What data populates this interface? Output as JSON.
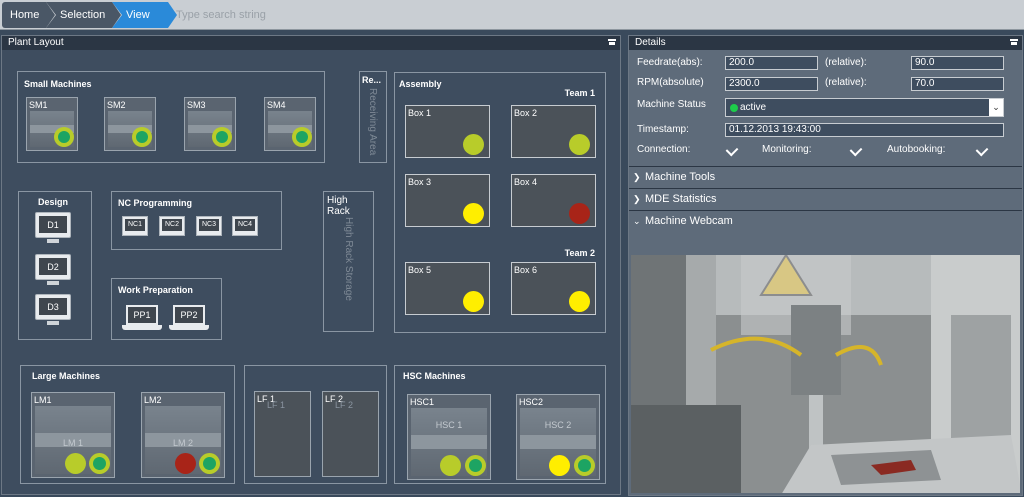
{
  "breadcrumb": {
    "home": "Home",
    "selection": "Selection",
    "view": "View",
    "search_placeholder": "Type search string"
  },
  "plant_layout": {
    "title": "Plant Layout",
    "small_machines": {
      "title": "Small Machines",
      "items": [
        {
          "label": "SM1"
        },
        {
          "label": "SM2"
        },
        {
          "label": "SM3"
        },
        {
          "label": "SM4"
        }
      ]
    },
    "receiving": {
      "label": "Re...",
      "vertical": "Receiving Area"
    },
    "assembly": {
      "title": "Assembly",
      "team1": "Team 1",
      "team2": "Team 2",
      "boxes": [
        {
          "label": "Box 1",
          "status_color": "#b8cc2a"
        },
        {
          "label": "Box 2",
          "status_color": "#b8cc2a"
        },
        {
          "label": "Box 3",
          "status_color": "#ffee00"
        },
        {
          "label": "Box 4",
          "status_color": "#a82418"
        },
        {
          "label": "Box 5",
          "status_color": "#ffee00"
        },
        {
          "label": "Box 6",
          "status_color": "#ffee00"
        }
      ]
    },
    "design": {
      "title": "Design",
      "items": [
        {
          "label": "D1"
        },
        {
          "label": "D2"
        },
        {
          "label": "D3"
        }
      ]
    },
    "nc_programming": {
      "title": "NC Programming",
      "items": [
        {
          "label": "NC1"
        },
        {
          "label": "NC2"
        },
        {
          "label": "NC3"
        },
        {
          "label": "NC4"
        }
      ]
    },
    "high_rack": {
      "label": "High Rack",
      "vertical": "High Rack Storage"
    },
    "work_preparation": {
      "title": "Work Preparation",
      "items": [
        {
          "label": "PP1"
        },
        {
          "label": "PP2"
        }
      ]
    },
    "large_machines": {
      "title": "Large Machines",
      "items": [
        {
          "label": "LM1",
          "inner": "LM 1",
          "status_color": "#b8cc2a"
        },
        {
          "label": "LM2",
          "inner": "LM 2",
          "status_color": "#a82418"
        }
      ]
    },
    "lf": {
      "items": [
        {
          "label": "LF 1",
          "inner": "LF 1"
        },
        {
          "label": "LF 2",
          "inner": "LF 2"
        }
      ]
    },
    "hsc": {
      "title": "HSC Machines",
      "items": [
        {
          "label": "HSC1",
          "inner": "HSC 1",
          "status_color": "#b8cc2a"
        },
        {
          "label": "HSC2",
          "inner": "HSC 2",
          "status_color": "#ffee00"
        }
      ]
    }
  },
  "details": {
    "title": "Details",
    "feedrate_label": "Feedrate(abs):",
    "feedrate_value": "200.0",
    "relative_label": "(relative):",
    "feedrate_rel": "90.0",
    "rpm_label": "RPM(absolute)",
    "rpm_value": "2300.0",
    "rpm_rel": "70.0",
    "status_label": "Machine Status",
    "status_value": "active",
    "status_color": "#1dcc4a",
    "timestamp_label": "Timestamp:",
    "timestamp_value": "01.12.2013 19:43:00",
    "connection_label": "Connection:",
    "monitoring_label": "Monitoring:",
    "autobooking_label": "Autobooking:",
    "sections": [
      {
        "label": "Machine Tools",
        "state": "collapsed"
      },
      {
        "label": "MDE Statistics",
        "state": "collapsed"
      },
      {
        "label": "Machine Webcam",
        "state": "expanded"
      }
    ]
  }
}
